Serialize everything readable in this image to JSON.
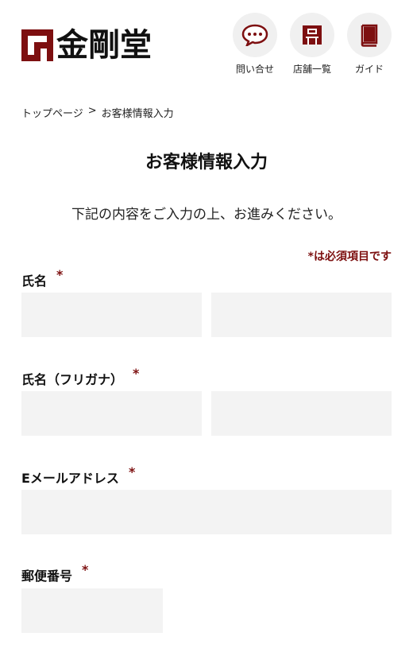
{
  "brand": {
    "name": "金剛堂",
    "accent": "#7d0f10"
  },
  "nav": [
    {
      "label": "問い合せ",
      "icon": "chat-bubble-icon"
    },
    {
      "label": "店舗一覧",
      "icon": "store-icon"
    },
    {
      "label": "ガイド",
      "icon": "book-icon"
    }
  ],
  "breadcrumb": {
    "home": "トップページ",
    "separator": ">",
    "current": "お客様情報入力"
  },
  "page": {
    "title": "お客様情報入力",
    "lead": "下記の内容をご入力の上、お進みください。",
    "required_note": "*は必須項目です"
  },
  "form": {
    "name": {
      "label": "氏名",
      "required_mark": "*",
      "last_value": "",
      "first_value": ""
    },
    "kana": {
      "label": "氏名（フリガナ）",
      "required_mark": "*",
      "last_value": "",
      "first_value": ""
    },
    "email": {
      "label": "Eメールアドレス",
      "required_mark": "*",
      "value": ""
    },
    "postal": {
      "label": "郵便番号",
      "required_mark": "*",
      "value": ""
    }
  }
}
